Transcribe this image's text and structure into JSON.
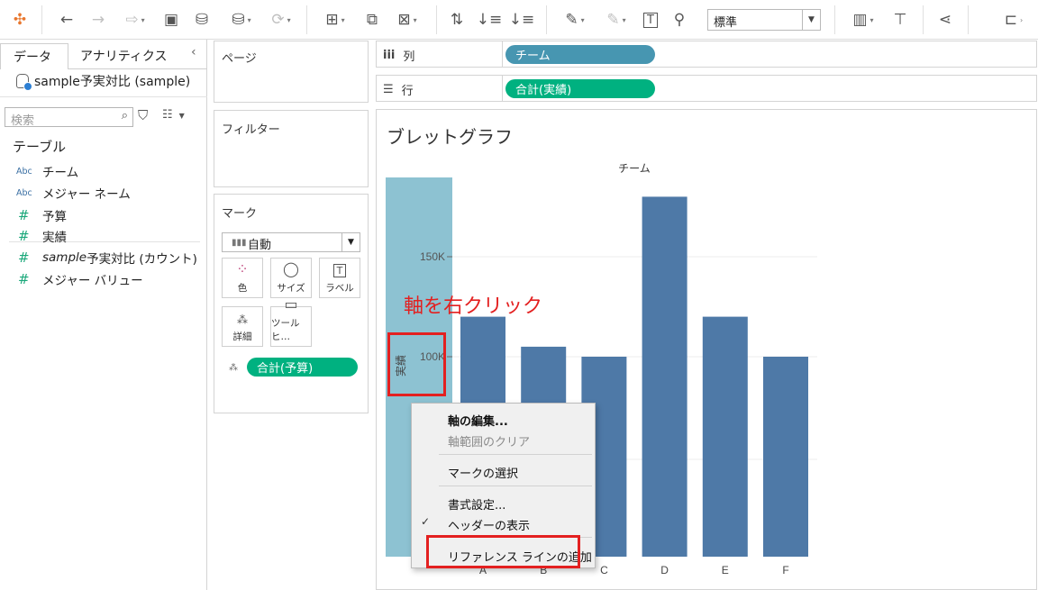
{
  "toolbar": {
    "fit_value": "標準"
  },
  "data_pane": {
    "tab_data": "データ",
    "tab_analytics": "アナリティクス",
    "datasource": "sample予実対比 (sample)",
    "search_placeholder": "検索",
    "tables_heading": "テーブル",
    "dimensions": [
      {
        "type": "Abc",
        "label": "チーム"
      },
      {
        "type": "Abc",
        "label": "メジャー ネーム"
      }
    ],
    "measures": [
      {
        "type": "#",
        "label": "予算"
      },
      {
        "type": "#",
        "label": "実績"
      },
      {
        "type": "#",
        "label_italic": "sample",
        "label_rest": "予実対比 (カウント)"
      },
      {
        "type": "#",
        "label": "メジャー バリュー"
      }
    ]
  },
  "cards": {
    "pages": "ページ",
    "filters": "フィルター",
    "marks": "マーク",
    "mark_type": "自動",
    "buttons": {
      "color": "色",
      "size": "サイズ",
      "label": "ラベル",
      "detail": "詳細",
      "tooltip": "ツールヒ…"
    },
    "budget_pill": "合計(予算)"
  },
  "shelves": {
    "columns_label": "列",
    "columns_pill": "チーム",
    "rows_label": "行",
    "rows_pill": "合計(実績)"
  },
  "view": {
    "title": "ブレットグラフ",
    "annotation": "軸を右クリック"
  },
  "chart_data": {
    "type": "bar",
    "column_header": "チーム",
    "axis_label": "実績",
    "ytick_labels": [
      "150K",
      "100K"
    ],
    "yticks": [
      150000,
      100000
    ],
    "categories": [
      "A",
      "B",
      "C",
      "D",
      "E",
      "F"
    ],
    "series": [
      {
        "name": "合計(実績)",
        "values": [
          120000,
          105000,
          100000,
          180000,
          120000,
          100000
        ]
      }
    ],
    "colors": {
      "bar": "#4e79a7",
      "selected_axis_highlight": "#8dc2d2"
    }
  },
  "context_menu": {
    "items": [
      {
        "label": "軸の編集...",
        "enabled": true,
        "bold": true
      },
      {
        "label": "軸範囲のクリア",
        "enabled": false
      },
      {
        "label": "マークの選択",
        "enabled": true
      },
      {
        "label": "書式設定...",
        "enabled": true
      },
      {
        "label": "ヘッダーの表示",
        "enabled": true,
        "checked": true
      },
      {
        "label": "リファレンス ラインの追加",
        "enabled": true
      }
    ]
  },
  "colors": {
    "pill_blue": "#4796b1",
    "pill_green": "#00b180",
    "annotation_red": "#e32020"
  }
}
